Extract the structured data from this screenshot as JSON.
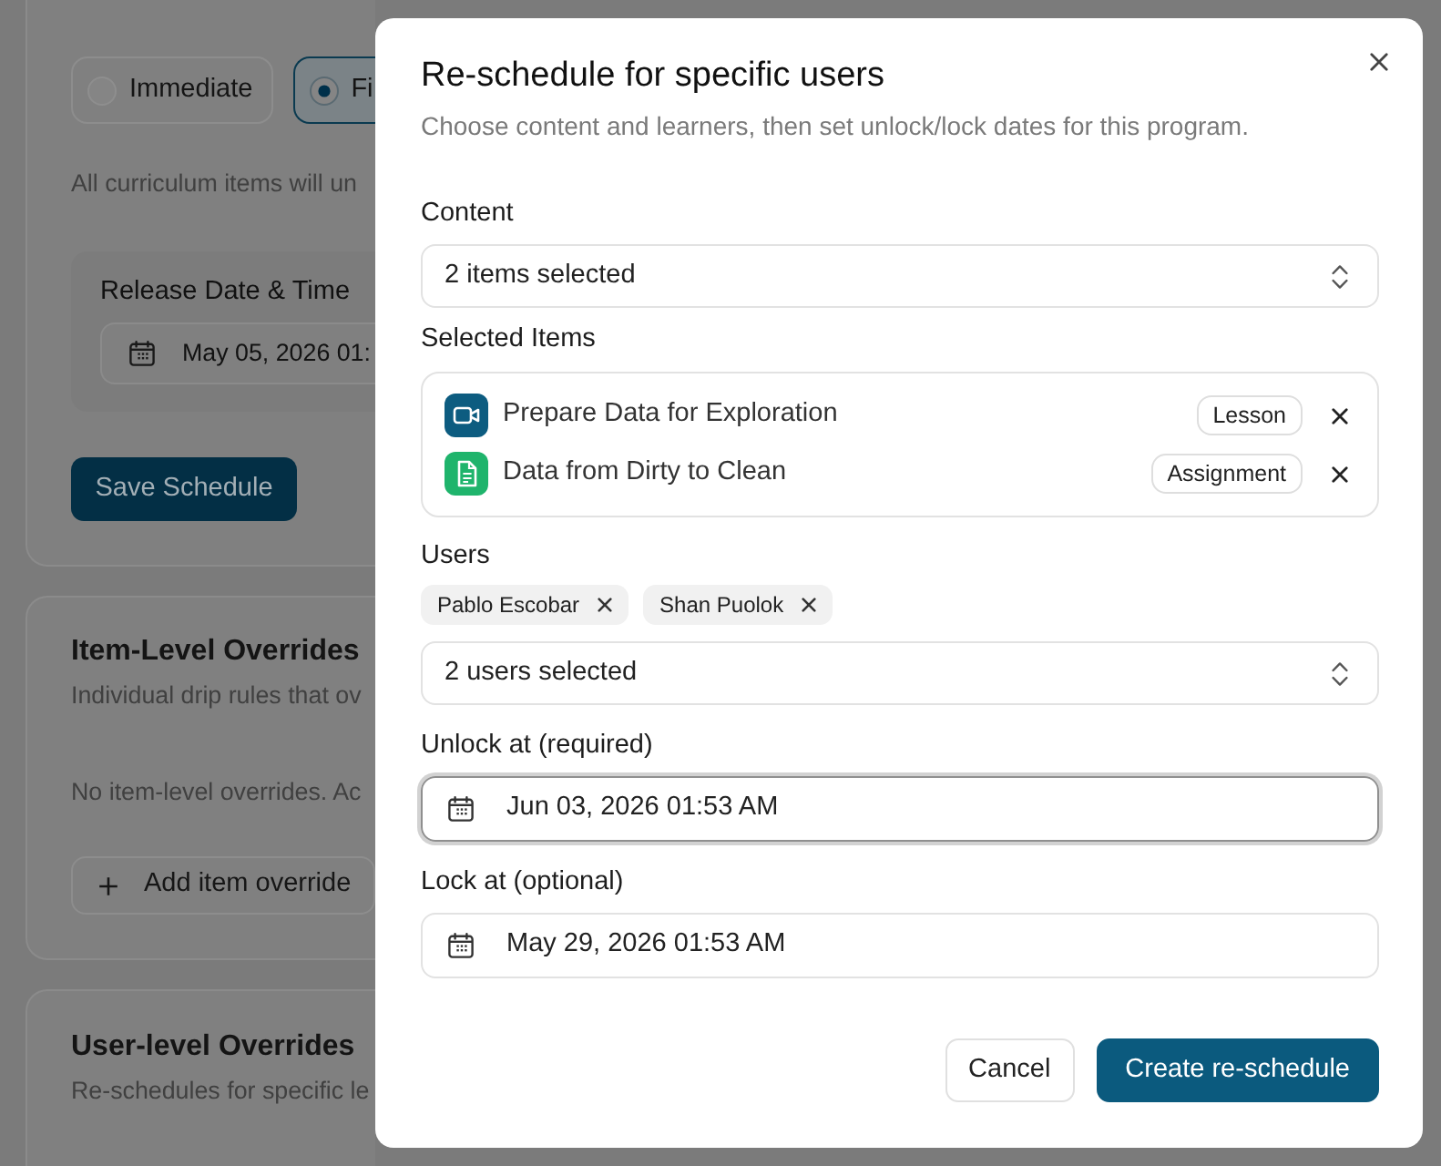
{
  "background": {
    "schedule_card": {
      "options": [
        {
          "label": "Immediate",
          "selected": false
        },
        {
          "label": "Fi",
          "selected": true
        }
      ],
      "note": "All curriculum items will un",
      "release": {
        "label": "Release Date & Time",
        "value": "May 05, 2026 01:"
      },
      "save_button": "Save Schedule"
    },
    "item_overrides": {
      "title": "Item-Level Overrides",
      "subtitle": "Individual drip rules that ov",
      "empty_text": "No item-level overrides. Ac",
      "add_button": "Add item override"
    },
    "user_overrides": {
      "title": "User-level Overrides",
      "subtitle": "Re-schedules for specific le"
    }
  },
  "dialog": {
    "title": "Re-schedule for specific users",
    "subtitle": "Choose content and learners, then set unlock/lock dates for this program.",
    "content": {
      "label": "Content",
      "value": "2 items selected"
    },
    "selected_items": {
      "label": "Selected Items",
      "items": [
        {
          "title": "Prepare Data for Exploration",
          "kind": "lesson",
          "tag": "Lesson"
        },
        {
          "title": "Data from Dirty to Clean",
          "kind": "assignment",
          "tag": "Assignment"
        }
      ]
    },
    "users": {
      "label": "Users",
      "chips": [
        "Pablo Escobar",
        "Shan Puolok"
      ],
      "value": "2 users selected"
    },
    "dates": [
      {
        "label": "Unlock at (required)",
        "value": "Jun 03, 2026 01:53 AM",
        "focused": true
      },
      {
        "label": "Lock at (optional)",
        "value": "May 29, 2026 01:53 AM",
        "focused": false
      }
    ],
    "buttons": [
      {
        "label": "Cancel",
        "kind": "secondary"
      },
      {
        "label": "Create re-schedule",
        "kind": "primary"
      }
    ]
  }
}
